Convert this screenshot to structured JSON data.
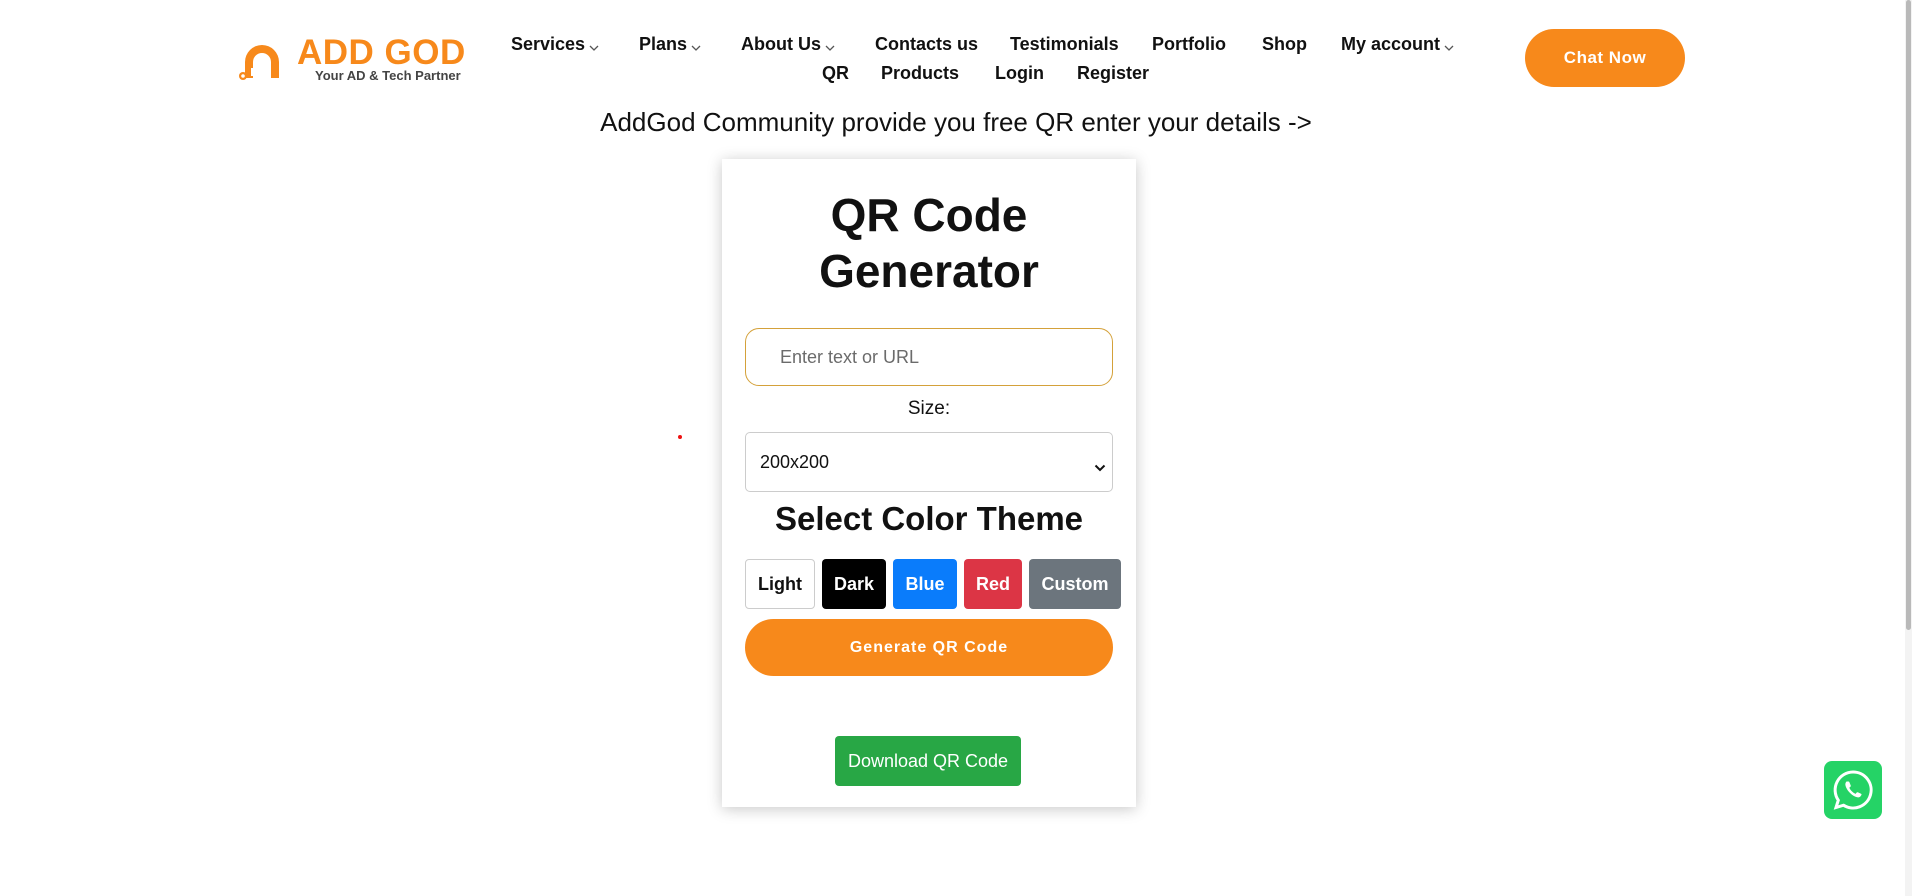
{
  "brand": {
    "name": "ADD GOD",
    "tagline": "Your AD & Tech Partner",
    "accent_color": "#f7891b"
  },
  "nav": {
    "items": [
      {
        "label": "Services",
        "dropdown": true
      },
      {
        "label": "Plans",
        "dropdown": true
      },
      {
        "label": "About Us",
        "dropdown": true
      },
      {
        "label": "Contacts us",
        "dropdown": false
      },
      {
        "label": "Testimonials",
        "dropdown": false
      },
      {
        "label": "Portfolio",
        "dropdown": false
      },
      {
        "label": "Shop",
        "dropdown": false
      },
      {
        "label": "My account",
        "dropdown": true
      },
      {
        "label": "QR",
        "dropdown": false
      },
      {
        "label": "Products",
        "dropdown": false
      },
      {
        "label": "Login",
        "dropdown": false
      },
      {
        "label": "Register",
        "dropdown": false
      }
    ],
    "cta_label": "Chat Now"
  },
  "intro_text": "AddGod Community provide you free QR enter your details ->",
  "generator": {
    "title_line1": "QR Code",
    "title_line2": "Generator",
    "input_value": "",
    "input_placeholder": "Enter text or URL",
    "size_label": "Size:",
    "size_selected": "200x200",
    "theme_title": "Select Color Theme",
    "themes": [
      {
        "label": "Light",
        "color": "#ffffff"
      },
      {
        "label": "Dark",
        "color": "#000000"
      },
      {
        "label": "Blue",
        "color": "#0a7cfb"
      },
      {
        "label": "Red",
        "color": "#dc3545"
      },
      {
        "label": "Custom",
        "color": "#6c757d"
      }
    ],
    "generate_label": "Generate QR Code",
    "download_label": "Download QR Code",
    "download_color": "#28a745"
  },
  "floating": {
    "whatsapp_icon": "whatsapp-icon",
    "whatsapp_color": "#25d366"
  }
}
